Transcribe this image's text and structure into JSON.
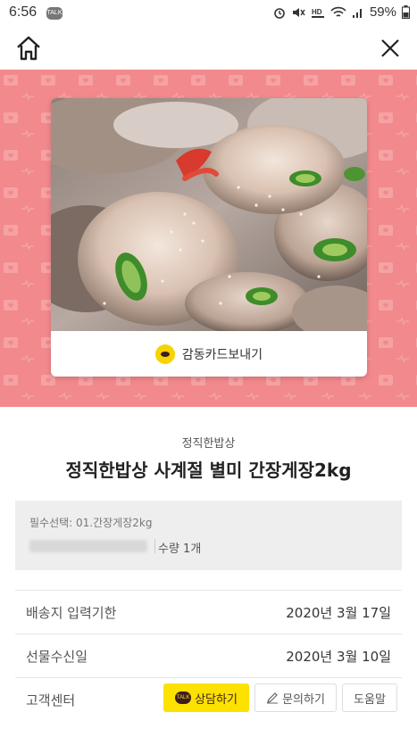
{
  "status_bar": {
    "time": "6:56",
    "notification_badge": "TALK",
    "battery": "59%",
    "icons": [
      "alarm-icon",
      "mute-icon",
      "hd-volte-icon",
      "wifi-icon",
      "signal-icon",
      "battery-icon"
    ]
  },
  "nav": {
    "home_icon": "home-icon",
    "close_icon": "close-icon"
  },
  "banner": {
    "background_color": "#f2898c"
  },
  "card": {
    "image_icon": "marinated-crab-photo",
    "footer_label": "감동카드보내기",
    "footer_icon": "kakaotalk-icon"
  },
  "product": {
    "brand": "정직한밥상",
    "title": "정직한밥상 사계절 별미 간장게장2kg"
  },
  "options": {
    "required_line": "필수선택: 01.간장게장2kg",
    "quantity": "수량 1개"
  },
  "info_rows": [
    {
      "label": "배송지 입력기한",
      "value": "2020년 3월 17일"
    },
    {
      "label": "선물수신일",
      "value": "2020년 3월 10일"
    }
  ],
  "support": {
    "label": "고객센터",
    "chat_button": "상담하기",
    "chat_badge": "TALK",
    "inquiry_button": "문의하기",
    "help_button": "도움말",
    "chat_color": "#fde100"
  }
}
